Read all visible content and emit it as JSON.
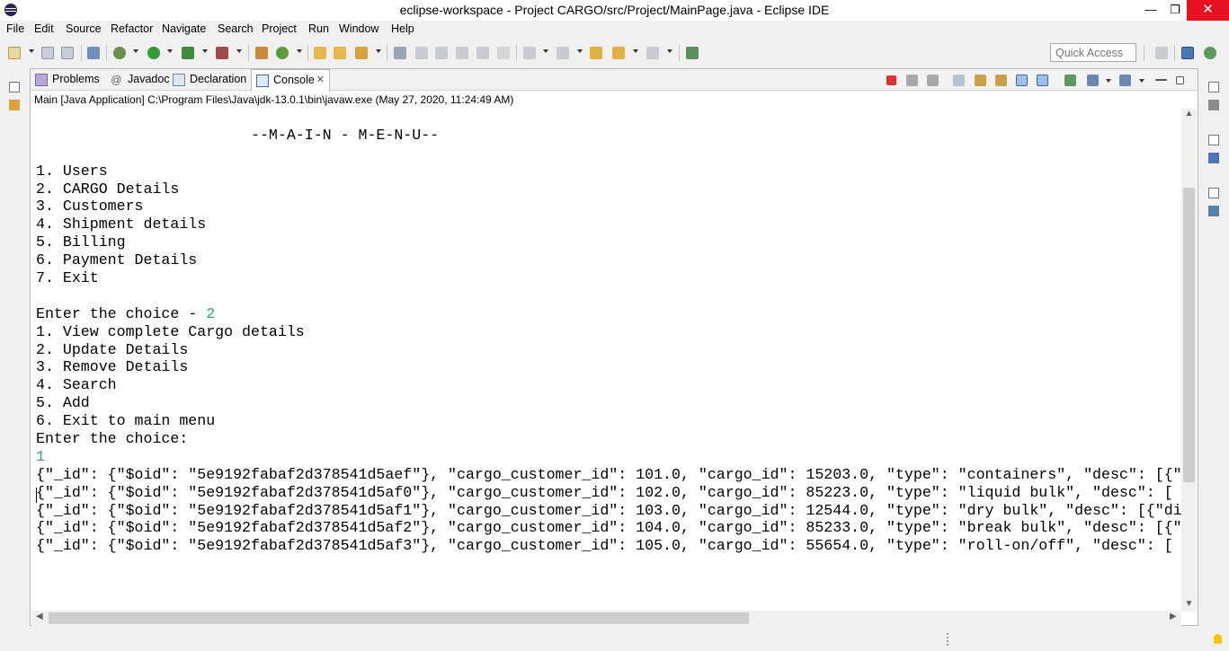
{
  "window": {
    "title": "eclipse-workspace - Project CARGO/src/Project/MainPage.java - Eclipse IDE",
    "minimize": "—",
    "maximize": "❐",
    "close": "✕"
  },
  "menu": [
    "File",
    "Edit",
    "Source",
    "Refactor",
    "Navigate",
    "Search",
    "Project",
    "Run",
    "Window",
    "Help"
  ],
  "toolbar": {
    "quick_access_placeholder": "Quick Access"
  },
  "tabs": [
    {
      "label": "Problems",
      "icon": "problems-icon"
    },
    {
      "label": "Javadoc",
      "icon": "at-icon"
    },
    {
      "label": "Declaration",
      "icon": "declaration-icon"
    },
    {
      "label": "Console",
      "icon": "console-icon",
      "active": true,
      "close": "✕"
    }
  ],
  "console": {
    "description": "Main [Java Application] C:\\Program Files\\Java\\jdk-13.0.1\\bin\\javaw.exe (May 27, 2020, 11:24:49 AM)",
    "input_color": "#2aa672",
    "lines": [
      {
        "text": ""
      },
      {
        "text": "                        --M-A-I-N - M-E-N-U--"
      },
      {
        "text": ""
      },
      {
        "text": "1. Users"
      },
      {
        "text": "2. CARGO Details"
      },
      {
        "text": "3. Customers"
      },
      {
        "text": "4. Shipment details"
      },
      {
        "text": "5. Billing"
      },
      {
        "text": "6. Payment Details"
      },
      {
        "text": "7. Exit"
      },
      {
        "text": ""
      },
      {
        "text": "Enter the choice - ",
        "input": "2"
      },
      {
        "text": "1. View complete Cargo details"
      },
      {
        "text": "2. Update Details"
      },
      {
        "text": "3. Remove Details"
      },
      {
        "text": "4. Search"
      },
      {
        "text": "5. Add"
      },
      {
        "text": "6. Exit to main menu"
      },
      {
        "text": "Enter the choice:"
      },
      {
        "text": "",
        "input": "1"
      },
      {
        "text": "{\"_id\": {\"$oid\": \"5e9192fabaf2d378541d5aef\"}, \"cargo_customer_id\": 101.0, \"cargo_id\": 15203.0, \"type\": \"containers\", \"desc\": [{\""
      },
      {
        "text": "{\"_id\": {\"$oid\": \"5e9192fabaf2d378541d5af0\"}, \"cargo_customer_id\": 102.0, \"cargo_id\": 85223.0, \"type\": \"liquid bulk\", \"desc\": ["
      },
      {
        "text": "{\"_id\": {\"$oid\": \"5e9192fabaf2d378541d5af1\"}, \"cargo_customer_id\": 103.0, \"cargo_id\": 12544.0, \"type\": \"dry bulk\", \"desc\": [{\"di"
      },
      {
        "text": "{\"_id\": {\"$oid\": \"5e9192fabaf2d378541d5af2\"}, \"cargo_customer_id\": 104.0, \"cargo_id\": 85233.0, \"type\": \"break bulk\", \"desc\": [{\""
      },
      {
        "text": "{\"_id\": {\"$oid\": \"5e9192fabaf2d378541d5af3\"}, \"cargo_customer_id\": 105.0, \"cargo_id\": 55654.0, \"type\": \"roll-on/off\", \"desc\": ["
      }
    ]
  },
  "colors": {
    "close_button": "#e81123",
    "terminate_red": "#e03030",
    "status_bulb": "#f5c400"
  }
}
